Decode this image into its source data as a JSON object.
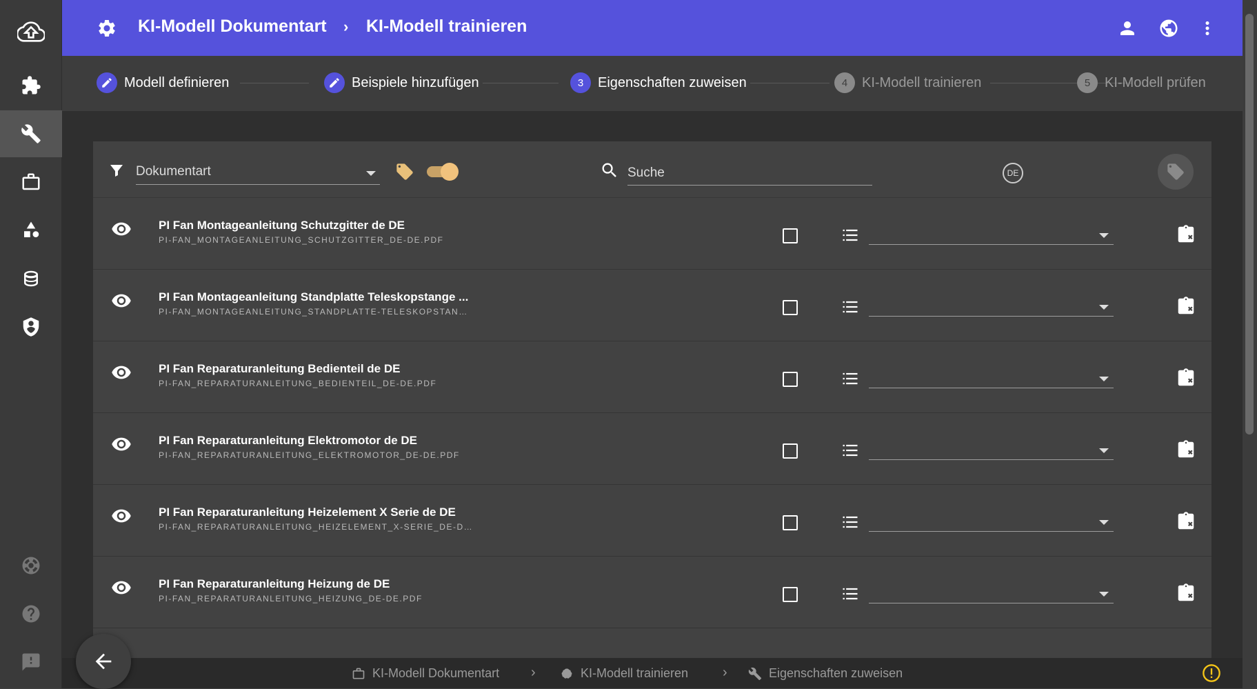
{
  "header": {
    "title_primary": "KI-Modell Dokumentart",
    "separator": "›",
    "title_secondary": "KI-Modell trainieren"
  },
  "stepper": {
    "steps": [
      {
        "number": "",
        "label": "Modell definieren",
        "state": "done"
      },
      {
        "number": "",
        "label": "Beispiele hinzufügen",
        "state": "done"
      },
      {
        "number": "3",
        "label": "Eigenschaften zuweisen",
        "state": "active"
      },
      {
        "number": "4",
        "label": "KI-Modell trainieren",
        "state": "pending"
      },
      {
        "number": "5",
        "label": "KI-Modell prüfen",
        "state": "pending"
      }
    ]
  },
  "filterbar": {
    "select_value": "Dokumentart",
    "search_placeholder": "Suche",
    "language_badge": "DE",
    "tag_toggle_on": true
  },
  "rows": [
    {
      "name": "PI Fan Montageanleitung Schutzgitter de DE",
      "file": "PI-FAN_MONTAGEANLEITUNG_SCHUTZGITTER_DE-DE.PDF",
      "checked": false
    },
    {
      "name": "PI Fan Montageanleitung Standplatte Teleskopstange ...",
      "file": "PI-FAN_MONTAGEANLEITUNG_STANDPLATTE-TELESKOPSTANG...",
      "checked": false
    },
    {
      "name": "PI Fan Reparaturanleitung Bedienteil de DE",
      "file": "PI-FAN_REPARATURANLEITUNG_BEDIENTEIL_DE-DE.PDF",
      "checked": false
    },
    {
      "name": "PI Fan Reparaturanleitung Elektromotor de DE",
      "file": "PI-FAN_REPARATURANLEITUNG_ELEKTROMOTOR_DE-DE.PDF",
      "checked": false
    },
    {
      "name": "PI Fan Reparaturanleitung Heizelement X Serie de DE",
      "file": "PI-FAN_REPARATURANLEITUNG_HEIZELEMENT_X-SERIE_DE-DE....",
      "checked": false
    },
    {
      "name": "PI Fan Reparaturanleitung Heizung de DE",
      "file": "PI-FAN_REPARATURANLEITUNG_HEIZUNG_DE-DE.PDF",
      "checked": false
    }
  ],
  "breadcrumb": {
    "items": [
      {
        "label": "KI-Modell Dokumentart",
        "icon": "briefcase-icon"
      },
      {
        "label": "KI-Modell trainieren",
        "icon": "brain-icon"
      },
      {
        "label": "Eigenschaften zuweisen",
        "icon": "wrench-icon"
      }
    ],
    "separator": "›"
  },
  "colors": {
    "accent": "#5552dc",
    "toggle": "#f1c27d",
    "background": "#424242"
  }
}
